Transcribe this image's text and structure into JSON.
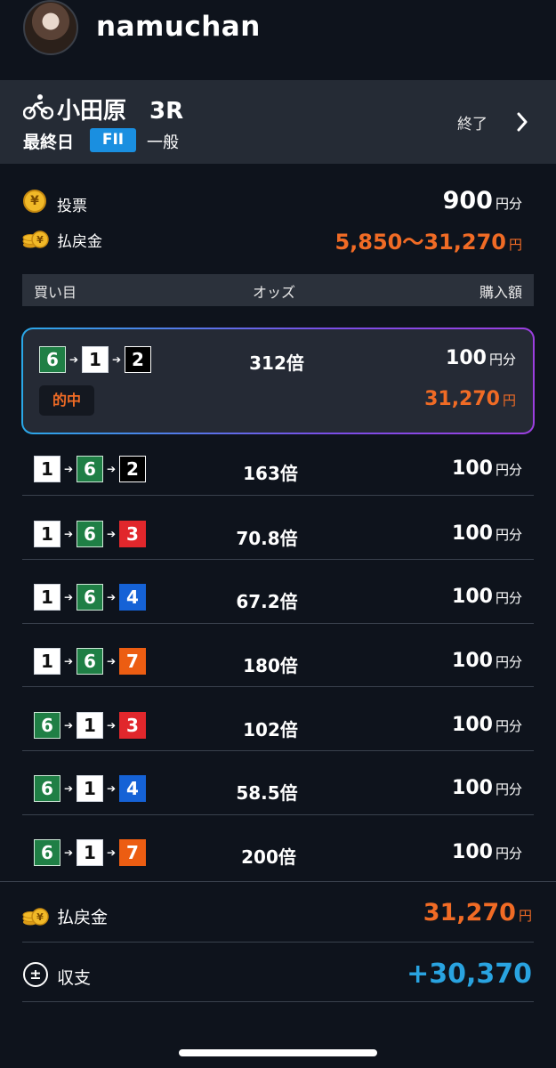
{
  "user": {
    "name": "namuchan"
  },
  "race": {
    "title": "小田原　3R",
    "day": "最終日",
    "grade": "FII",
    "type": "一般",
    "status": "終了"
  },
  "summary": {
    "vote_label": "投票",
    "vote_amount": "900",
    "vote_unit": "円分",
    "payout_label": "払戻金",
    "payout_range": "5,850〜31,270",
    "payout_unit": "円"
  },
  "table": {
    "headers": [
      "買い目",
      "オッズ",
      "購入額"
    ],
    "hit_label": "的中",
    "rows": [
      {
        "combo": [
          "6",
          "1",
          "2"
        ],
        "odds": "312倍",
        "amount": "100",
        "unit": "円分",
        "hit": true,
        "payout": "31,270",
        "payout_unit": "円"
      },
      {
        "combo": [
          "1",
          "6",
          "2"
        ],
        "odds": "163倍",
        "amount": "100",
        "unit": "円分"
      },
      {
        "combo": [
          "1",
          "6",
          "3"
        ],
        "odds": "70.8倍",
        "amount": "100",
        "unit": "円分"
      },
      {
        "combo": [
          "1",
          "6",
          "4"
        ],
        "odds": "67.2倍",
        "amount": "100",
        "unit": "円分"
      },
      {
        "combo": [
          "1",
          "6",
          "7"
        ],
        "odds": "180倍",
        "amount": "100",
        "unit": "円分"
      },
      {
        "combo": [
          "6",
          "1",
          "3"
        ],
        "odds": "102倍",
        "amount": "100",
        "unit": "円分"
      },
      {
        "combo": [
          "6",
          "1",
          "4"
        ],
        "odds": "58.5倍",
        "amount": "100",
        "unit": "円分"
      },
      {
        "combo": [
          "6",
          "1",
          "7"
        ],
        "odds": "200倍",
        "amount": "100",
        "unit": "円分"
      }
    ]
  },
  "footer": {
    "payout_label": "払戻金",
    "payout_amount": "31,270",
    "payout_unit": "円",
    "balance_label": "収支",
    "balance_amount": "+30,370"
  },
  "colors": {
    "accent_orange": "#f06b25",
    "accent_blue": "#29a3e0",
    "background": "#0e131c"
  },
  "icons": {
    "bike": "bicycle-icon",
    "chevron": "chevron-right-icon",
    "yen": "yen-coin-icon",
    "coins": "coins-stack-icon",
    "plusminus": "plus-minus-icon"
  }
}
